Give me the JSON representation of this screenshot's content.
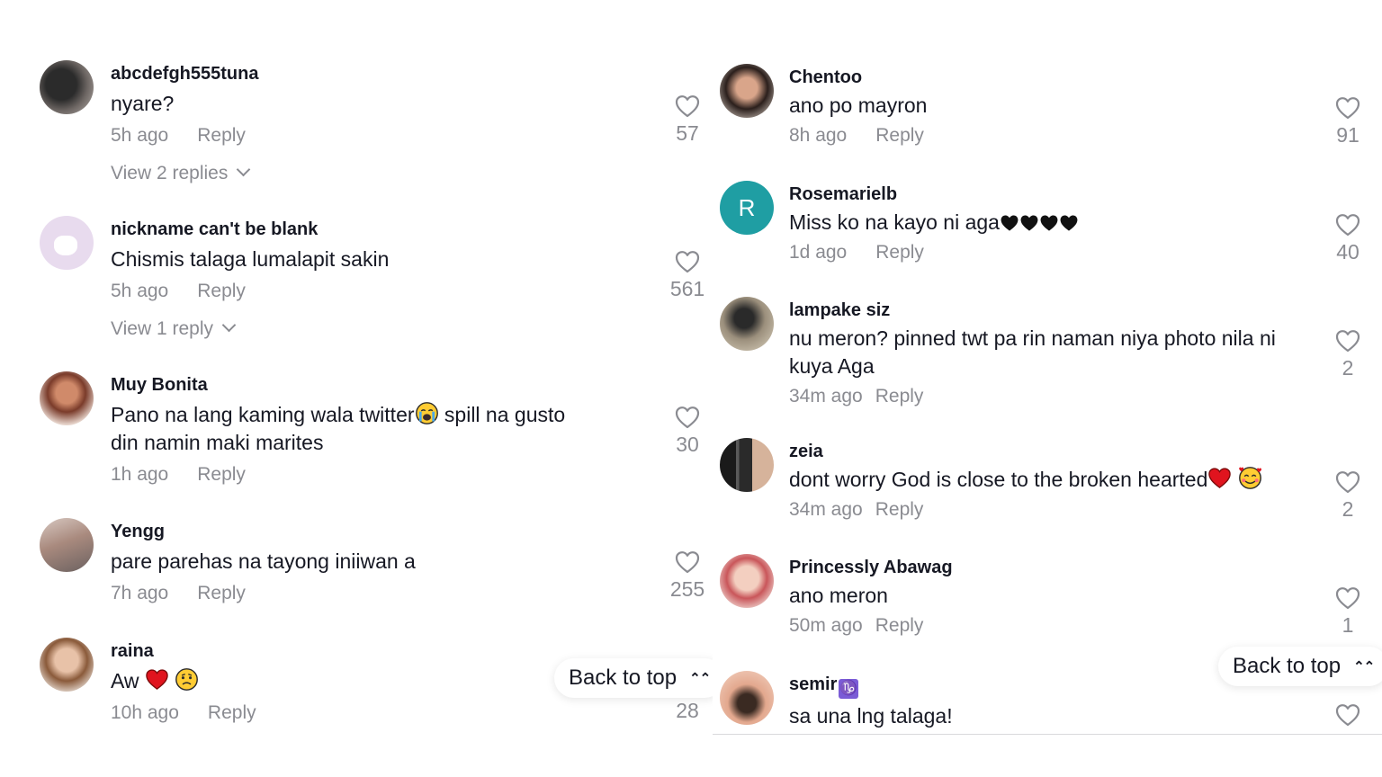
{
  "left": {
    "comments": [
      {
        "username": "abcdefgh555tuna",
        "text": "nyare?",
        "time": "5h ago",
        "reply": "Reply",
        "likes": "57",
        "view_replies": "View 2 replies"
      },
      {
        "username": "nickname can't be blank",
        "text": "Chismis talaga lumalapit sakin",
        "time": "5h ago",
        "reply": "Reply",
        "likes": "561",
        "view_replies": "View 1 reply"
      },
      {
        "username": "Muy Bonita",
        "text_a": "Pano na lang kaming wala twitter",
        "text_b": " spill na gusto",
        "text_line2": "din namin maki marites",
        "time": "1h ago",
        "reply": "Reply",
        "likes": "30"
      },
      {
        "username": "Yengg",
        "text": "pare parehas na tayong iniiwan a",
        "time": "7h ago",
        "reply": "Reply",
        "likes": "255"
      },
      {
        "username": "raina",
        "text": "Aw ",
        "time": "10h ago",
        "reply": "Reply",
        "likes": "28"
      }
    ],
    "back_to_top": "Back to top"
  },
  "right": {
    "comments": [
      {
        "username": "Chentoo",
        "text": "ano po mayron",
        "time": "8h ago",
        "reply": "Reply",
        "likes": "91"
      },
      {
        "username": "Rosemarielb",
        "avatar_letter": "R",
        "text": "Miss ko na kayo ni aga",
        "time": "1d ago",
        "reply": "Reply",
        "likes": "40"
      },
      {
        "username": "lampake siz",
        "text": "nu meron? pinned twt pa rin naman niya photo nila ni",
        "text_line2": "kuya Aga",
        "time": "34m ago",
        "reply": "Reply",
        "likes": "2"
      },
      {
        "username": "zeia",
        "text": "dont worry God is close to the broken hearted",
        "time": "34m ago",
        "reply": "Reply",
        "likes": "2"
      },
      {
        "username": "Princessly Abawag",
        "text": "ano meron",
        "time": "50m ago",
        "reply": "Reply",
        "likes": "1"
      },
      {
        "username": "semir",
        "text": "sa una lng talaga!"
      }
    ],
    "back_to_top": "Back to top"
  },
  "colors": {
    "text": "#161823",
    "muted": "#8a8b91",
    "avatar_teal": "#1f9ea3",
    "heart_red": "#e0141e"
  },
  "icons": {
    "like": "heart-outline-icon",
    "expand": "chevron-down-icon",
    "scroll_up": "double-chevron-up-icon",
    "zodiac": "capricorn-icon"
  }
}
